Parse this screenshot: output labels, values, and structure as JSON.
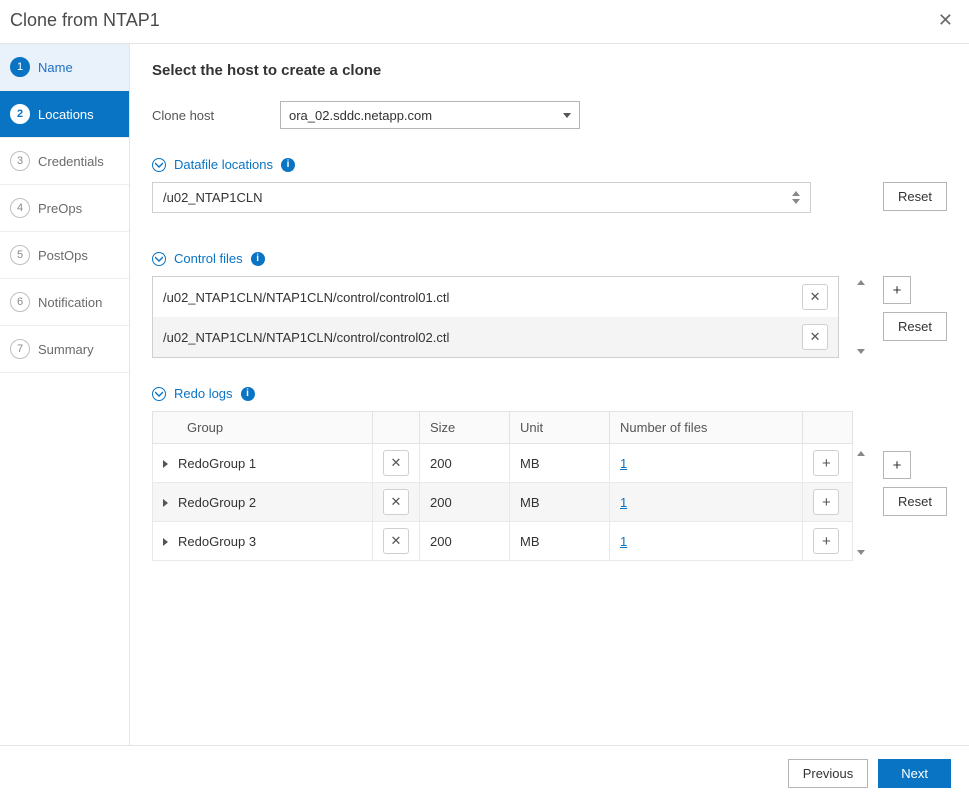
{
  "title": "Clone from NTAP1",
  "steps": [
    {
      "num": "1",
      "label": "Name",
      "state": "completed"
    },
    {
      "num": "2",
      "label": "Locations",
      "state": "active"
    },
    {
      "num": "3",
      "label": "Credentials",
      "state": ""
    },
    {
      "num": "4",
      "label": "PreOps",
      "state": ""
    },
    {
      "num": "5",
      "label": "PostOps",
      "state": ""
    },
    {
      "num": "6",
      "label": "Notification",
      "state": ""
    },
    {
      "num": "7",
      "label": "Summary",
      "state": ""
    }
  ],
  "heading": "Select the host to create a clone",
  "clone_host_label": "Clone host",
  "clone_host_value": "ora_02.sddc.netapp.com",
  "sections": {
    "datafile": {
      "title": "Datafile locations",
      "value": "/u02_NTAP1CLN",
      "reset": "Reset"
    },
    "control": {
      "title": "Control files",
      "rows": [
        "/u02_NTAP1CLN/NTAP1CLN/control/control01.ctl",
        "/u02_NTAP1CLN/NTAP1CLN/control/control02.ctl"
      ],
      "reset": "Reset",
      "add": "+"
    },
    "redo": {
      "title": "Redo logs",
      "headers": {
        "group": "Group",
        "size": "Size",
        "unit": "Unit",
        "num": "Number of files"
      },
      "rows": [
        {
          "group": "RedoGroup 1",
          "size": "200",
          "unit": "MB",
          "num": "1"
        },
        {
          "group": "RedoGroup 2",
          "size": "200",
          "unit": "MB",
          "num": "1"
        },
        {
          "group": "RedoGroup 3",
          "size": "200",
          "unit": "MB",
          "num": "1"
        }
      ],
      "reset": "Reset",
      "add": "+"
    }
  },
  "footer": {
    "previous": "Previous",
    "next": "Next"
  }
}
